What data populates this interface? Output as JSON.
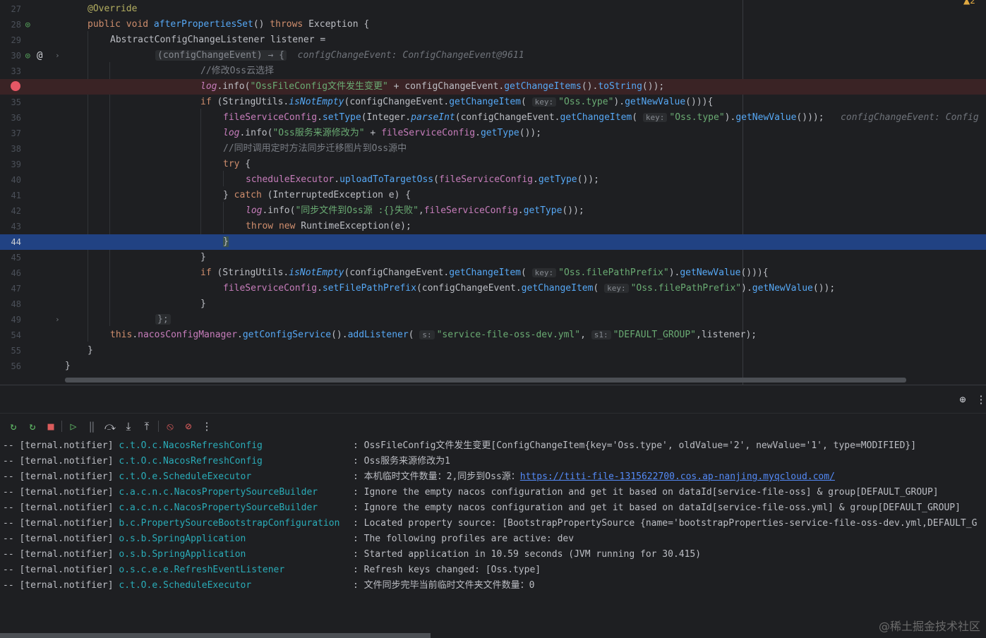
{
  "editor": {
    "warning_badge": "▲2",
    "lines": [
      {
        "n": "27"
      },
      {
        "n": "28"
      },
      {
        "n": "29"
      },
      {
        "n": "30"
      },
      {
        "n": "33"
      },
      {
        "n": "34"
      },
      {
        "n": "35"
      },
      {
        "n": "36"
      },
      {
        "n": "37"
      },
      {
        "n": "38"
      },
      {
        "n": "39"
      },
      {
        "n": "40"
      },
      {
        "n": "41"
      },
      {
        "n": "42"
      },
      {
        "n": "43"
      },
      {
        "n": "44"
      },
      {
        "n": "45"
      },
      {
        "n": "46"
      },
      {
        "n": "47"
      },
      {
        "n": "48"
      },
      {
        "n": "49"
      },
      {
        "n": "54"
      },
      {
        "n": "55"
      },
      {
        "n": "56"
      }
    ],
    "code": {
      "l27": "@Override",
      "l28a": "public void ",
      "l28b": "afterPropertiesSet",
      "l28c": "() ",
      "l28d": "throws ",
      "l28e": "Exception {",
      "l29": "AbstractConfigChangeListener listener =",
      "l30a": "(configChangeEvent) → {",
      "l30hint": "configChangeEvent: ConfigChangeEvent@9611",
      "l33": "//修改Oss云选择",
      "l34a": "log",
      "l34b": ".info(",
      "l34c": "\"OssFileConfig文件发生变更\"",
      "l34d": " + configChangeEvent.",
      "l34e": "getChangeItems",
      "l34f": "().",
      "l34g": "toString",
      "l34h": "());",
      "l35a": "if ",
      "l35b": "(StringUtils.",
      "l35c": "isNotEmpty",
      "l35d": "(configChangeEvent.",
      "l35e": "getChangeItem",
      "l35f": "(",
      "l35key": "key:",
      "l35g": "\"Oss.type\"",
      "l35h": ").",
      "l35i": "getNewValue",
      "l35j": "())){",
      "l36a": "fileServiceConfig",
      "l36b": ".",
      "l36c": "setType",
      "l36d": "(Integer.",
      "l36e": "parseInt",
      "l36f": "(configChangeEvent.",
      "l36g": "getChangeItem",
      "l36h": "(",
      "l36key": "key:",
      "l36i": "\"Oss.type\"",
      "l36j": ").",
      "l36k": "getNewValue",
      "l36l": "()));",
      "l36hint": "configChangeEvent: Config",
      "l37a": "log",
      "l37b": ".info(",
      "l37c": "\"Oss服务来源修改为\"",
      "l37d": " + ",
      "l37e": "fileServiceConfig",
      "l37f": ".",
      "l37g": "getType",
      "l37h": "());",
      "l38": "//同时调用定时方法同步迁移图片到Oss源中",
      "l39a": "try",
      "l39b": " {",
      "l40a": "scheduleExecutor",
      "l40b": ".",
      "l40c": "uploadToTargetOss",
      "l40d": "(",
      "l40e": "fileServiceConfig",
      "l40f": ".",
      "l40g": "getType",
      "l40h": "());",
      "l41a": "} ",
      "l41b": "catch",
      "l41c": " (InterruptedException e) {",
      "l42a": "log",
      "l42b": ".info(",
      "l42c": "\"同步文件到Oss源 :{}失败\"",
      "l42d": ",",
      "l42e": "fileServiceConfig",
      "l42f": ".",
      "l42g": "getType",
      "l42h": "());",
      "l43a": "throw new ",
      "l43b": "RuntimeException(e);",
      "l44": "}",
      "l45": "}",
      "l46a": "if ",
      "l46b": "(StringUtils.",
      "l46c": "isNotEmpty",
      "l46d": "(configChangeEvent.",
      "l46e": "getChangeItem",
      "l46f": "(",
      "l46key": "key:",
      "l46g": "\"Oss.filePathPrefix\"",
      "l46h": ").",
      "l46i": "getNewValue",
      "l46j": "())){",
      "l47a": "fileServiceConfig",
      "l47b": ".",
      "l47c": "setFilePathPrefix",
      "l47d": "(configChangeEvent.",
      "l47e": "getChangeItem",
      "l47f": "(",
      "l47key": "key:",
      "l47g": "\"Oss.filePathPrefix\"",
      "l47h": ").",
      "l47i": "getNewValue",
      "l47j": "());",
      "l48": "}",
      "l49": "};",
      "l54a": "this",
      "l54b": ".",
      "l54c": "nacosConfigManager",
      "l54d": ".",
      "l54e": "getConfigService",
      "l54f": "().",
      "l54g": "addListener",
      "l54h": "(",
      "l54key1": "s:",
      "l54i": "\"service-file-oss-dev.yml\"",
      "l54j": ", ",
      "l54key2": "s1:",
      "l54k": "\"DEFAULT_GROUP\"",
      "l54l": ",listener);",
      "l55": "}",
      "l56": "}"
    }
  },
  "toolbar": {
    "icons": [
      "rerun-icon",
      "rerun-failed-icon",
      "stop-icon",
      "resume-icon",
      "pause-icon",
      "step-over-icon",
      "step-into-icon",
      "step-out-icon",
      "view-breakpoints-icon",
      "mute-breakpoints-icon",
      "more-icon"
    ],
    "glyphs": [
      "↻",
      "↻",
      "■",
      "▷",
      "‖",
      "⤼",
      "⤓",
      "⤒",
      "⦸",
      "⊘",
      "⋮"
    ]
  },
  "panel_header": {
    "glyph_target": "⊕",
    "glyph_more": "⋮"
  },
  "console": {
    "lines": [
      {
        "pre": "-- [ternal.notifier] ",
        "logger": "c.t.O.c.NacosRefreshConfig",
        "msg": ": OssFileConfig文件发生变更[ConfigChangeItem{key='Oss.type', oldValue='2', newValue='1', type=MODIFIED}]"
      },
      {
        "pre": "-- [ternal.notifier] ",
        "logger": "c.t.O.c.NacosRefreshConfig",
        "msg": ": Oss服务来源修改为1"
      },
      {
        "pre": "-- [ternal.notifier] ",
        "logger": "c.t.O.e.ScheduleExecutor",
        "msg": ": 本机临时文件数量：2,同步到Oss源：",
        "link": "https://titi-file-1315622700.cos.ap-nanjing.myqcloud.com/"
      },
      {
        "pre": "-- [ternal.notifier] ",
        "logger": "c.a.c.n.c.NacosPropertySourceBuilder",
        "msg": ": Ignore the empty nacos configuration and get it based on dataId[service-file-oss] & group[DEFAULT_GROUP]"
      },
      {
        "pre": "-- [ternal.notifier] ",
        "logger": "c.a.c.n.c.NacosPropertySourceBuilder",
        "msg": ": Ignore the empty nacos configuration and get it based on dataId[service-file-oss.yml] & group[DEFAULT_GROUP]"
      },
      {
        "pre": "-- [ternal.notifier] ",
        "logger": "b.c.PropertySourceBootstrapConfiguration",
        "msg": ": Located property source: [BootstrapPropertySource {name='bootstrapProperties-service-file-oss-dev.yml,DEFAULT_G"
      },
      {
        "pre": "-- [ternal.notifier] ",
        "logger": "o.s.b.SpringApplication",
        "msg": ": The following profiles are active: dev"
      },
      {
        "pre": "-- [ternal.notifier] ",
        "logger": "o.s.b.SpringApplication",
        "msg": ": Started application in 10.59 seconds (JVM running for 30.415)"
      },
      {
        "pre": "-- [ternal.notifier] ",
        "logger": "o.s.c.e.e.RefreshEventListener",
        "msg": ": Refresh keys changed: [Oss.type]"
      },
      {
        "pre": "-- [ternal.notifier] ",
        "logger": "c.t.O.e.ScheduleExecutor",
        "msg": ": 文件同步完毕当前临时文件夹文件数量：0"
      }
    ]
  },
  "watermark": "@稀土掘金技术社区"
}
